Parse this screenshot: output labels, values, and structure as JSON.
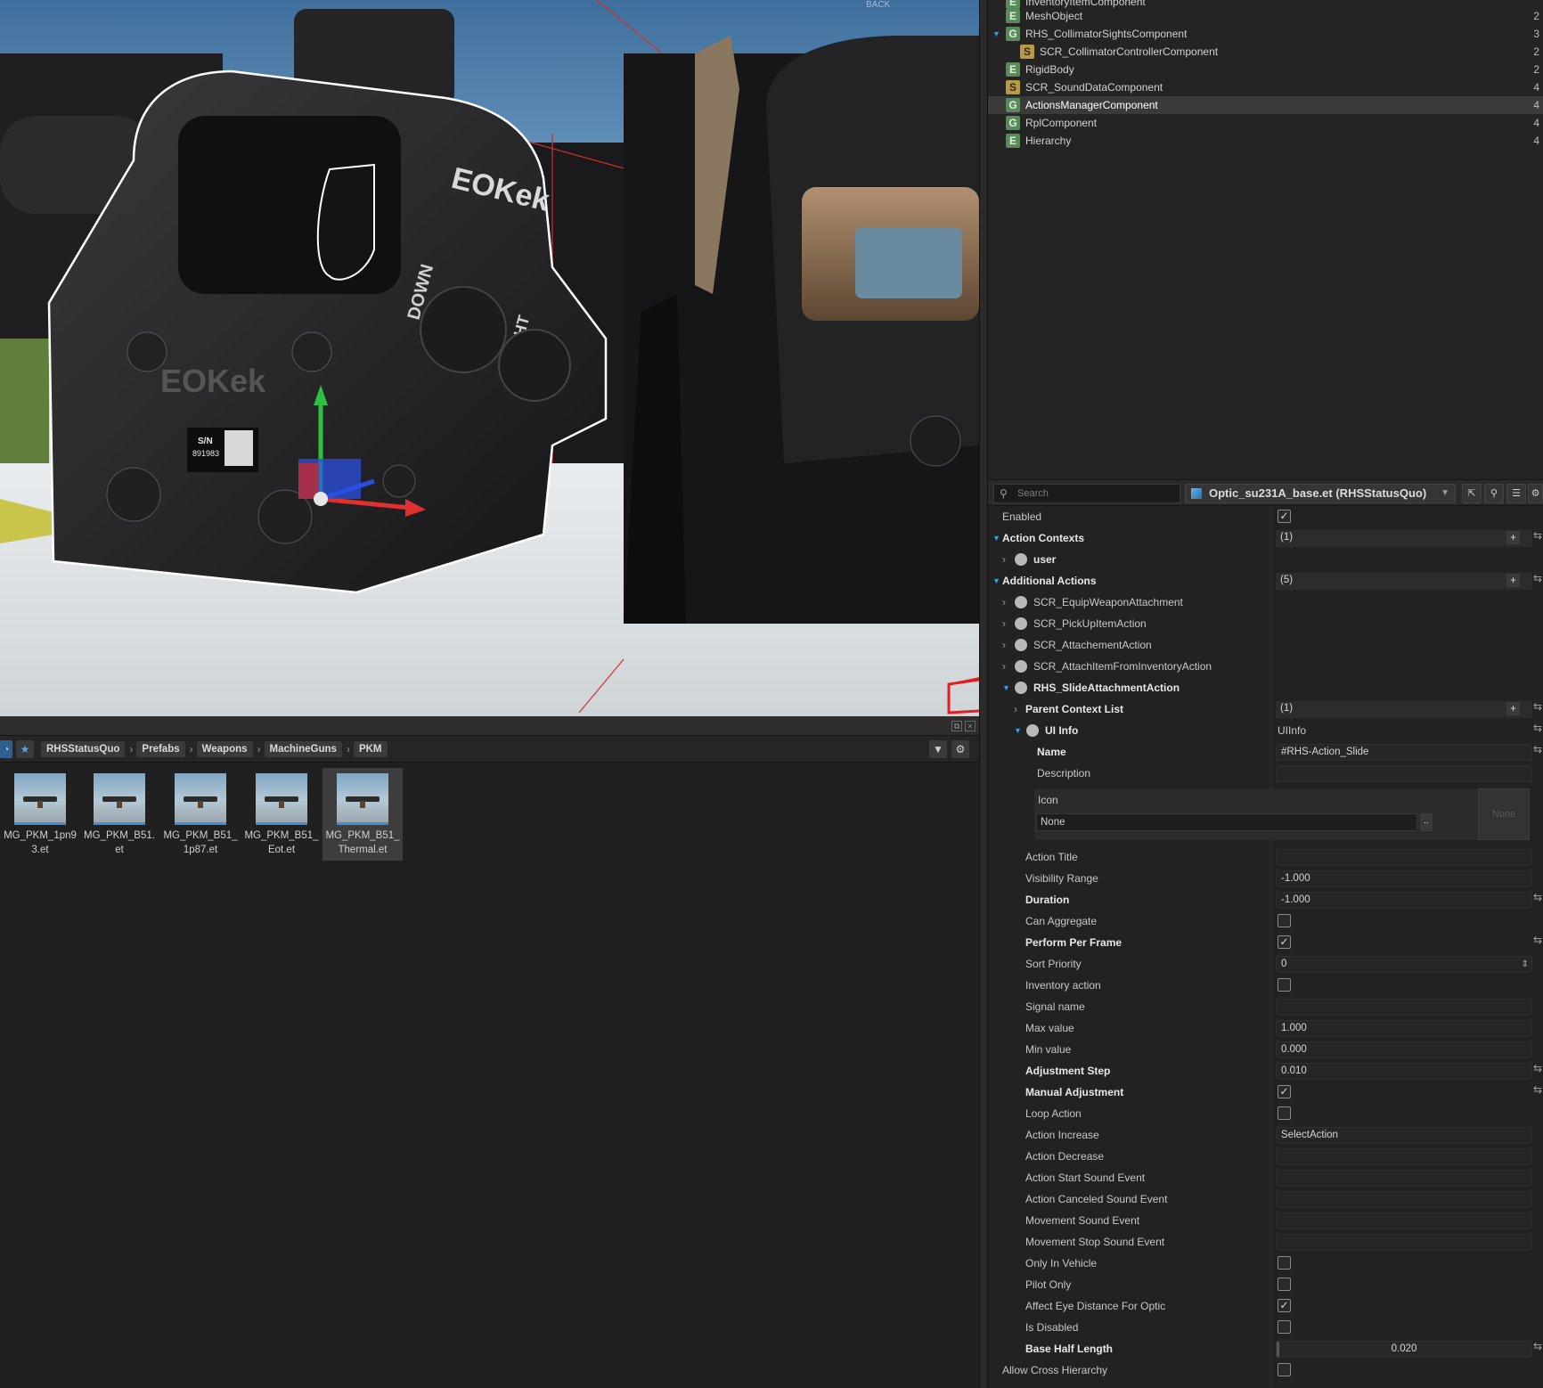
{
  "viewport": {
    "sight_brand_front": "EOKek",
    "sight_brand_side": "EOKek",
    "serial_label": "S/N",
    "serial_number": "891983",
    "dial_down": "DOWN",
    "dial_right": "RIGHT",
    "back_label": "BACK"
  },
  "hierarchy": {
    "items": [
      {
        "badge": "E",
        "name": "InventoryItemComponent",
        "count": "",
        "indent": 1,
        "caret": false
      },
      {
        "badge": "E",
        "name": "MeshObject",
        "count": "2",
        "indent": 1,
        "caret": false
      },
      {
        "badge": "G",
        "name": "RHS_CollimatorSightsComponent",
        "count": "3",
        "indent": 1,
        "caret": true
      },
      {
        "badge": "S",
        "name": "SCR_CollimatorControllerComponent",
        "count": "2",
        "indent": 2,
        "caret": false
      },
      {
        "badge": "E",
        "name": "RigidBody",
        "count": "2",
        "indent": 1,
        "caret": false
      },
      {
        "badge": "S",
        "name": "SCR_SoundDataComponent",
        "count": "4",
        "indent": 1,
        "caret": false
      },
      {
        "badge": "G",
        "name": "ActionsManagerComponent",
        "count": "4",
        "indent": 1,
        "caret": false,
        "selected": true
      },
      {
        "badge": "G",
        "name": "RplComponent",
        "count": "4",
        "indent": 1,
        "caret": false
      },
      {
        "badge": "E",
        "name": "Hierarchy",
        "count": "4",
        "indent": 1,
        "caret": false
      }
    ]
  },
  "props_toolbar": {
    "search_placeholder": "Search",
    "entity": "Optic_su231A_base.et (RHSStatusQuo)"
  },
  "properties": {
    "enabled": {
      "label": "Enabled",
      "checked": true
    },
    "action_contexts": {
      "label": "Action Contexts",
      "count": "(1)"
    },
    "user": "user",
    "additional_actions": {
      "label": "Additional Actions",
      "count": "(5)"
    },
    "actions": [
      "SCR_EquipWeaponAttachment",
      "SCR_PickUpItemAction",
      "SCR_AttachementAction",
      "SCR_AttachItemFromInventoryAction",
      "RHS_SlideAttachmentAction"
    ],
    "parent_context_list": {
      "label": "Parent Context List",
      "count": "(1)"
    },
    "ui_info": {
      "label": "UI Info",
      "value": "UIInfo"
    },
    "name": {
      "label": "Name",
      "value": "#RHS-Action_Slide"
    },
    "description": {
      "label": "Description",
      "value": ""
    },
    "icon": {
      "label": "Icon",
      "value": "None",
      "browse": "..",
      "preview": "None"
    },
    "action_title": {
      "label": "Action Title",
      "value": ""
    },
    "visibility_range": {
      "label": "Visibility Range",
      "value": "-1.000"
    },
    "duration": {
      "label": "Duration",
      "value": "-1.000"
    },
    "can_aggregate": {
      "label": "Can Aggregate",
      "checked": false
    },
    "perform_per_frame": {
      "label": "Perform Per Frame",
      "checked": true
    },
    "sort_priority": {
      "label": "Sort  Priority",
      "value": "0"
    },
    "inventory_action": {
      "label": "Inventory action",
      "checked": false
    },
    "signal_name": {
      "label": "Signal name",
      "value": ""
    },
    "max_value": {
      "label": "Max value",
      "value": "1.000"
    },
    "min_value": {
      "label": "Min value",
      "value": "0.000"
    },
    "adjustment_step": {
      "label": "Adjustment Step",
      "value": "0.010"
    },
    "manual_adjustment": {
      "label": "Manual Adjustment",
      "checked": true
    },
    "loop_action": {
      "label": "Loop Action",
      "checked": false
    },
    "action_increase": {
      "label": "Action Increase",
      "value": "SelectAction"
    },
    "action_decrease": {
      "label": "Action Decrease",
      "value": ""
    },
    "action_start_sound": {
      "label": "Action Start Sound Event",
      "value": ""
    },
    "action_canceled_sound": {
      "label": "Action Canceled Sound Event",
      "value": ""
    },
    "movement_sound": {
      "label": "Movement Sound Event",
      "value": ""
    },
    "movement_stop_sound": {
      "label": "Movement Stop Sound Event",
      "value": ""
    },
    "only_in_vehicle": {
      "label": "Only In Vehicle",
      "checked": false
    },
    "pilot_only": {
      "label": "Pilot Only",
      "checked": false
    },
    "affect_eye_distance": {
      "label": "Affect Eye Distance For Optic",
      "checked": true
    },
    "is_disabled": {
      "label": "Is Disabled",
      "checked": false
    },
    "base_half_length": {
      "label": "Base Half Length",
      "value": "0.020"
    },
    "allow_cross_hierarchy": {
      "label": "Allow Cross Hierarchy",
      "checked": false
    }
  },
  "asset_browser": {
    "breadcrumbs": [
      "RHSStatusQuo",
      "Prefabs",
      "Weapons",
      "MachineGuns",
      "PKM"
    ],
    "files": [
      {
        "line1": "MG_PKM_1pn9",
        "line2": "3.et"
      },
      {
        "line1": "MG_PKM_B51.",
        "line2": "et"
      },
      {
        "line1": "MG_PKM_B51_",
        "line2": "1p87.et"
      },
      {
        "line1": "MG_PKM_B51_",
        "line2": "Eot.et"
      },
      {
        "line1": "MG_PKM_B51_",
        "line2": "Thermal.et",
        "selected": true
      }
    ]
  },
  "colors": {
    "accent_blue": "#3f9be0",
    "selection_bg": "#3a3a3a",
    "badge_green": "#5a8a5a",
    "badge_yellow": "#b99a44",
    "gizmo_red": "#e03030",
    "gizmo_green": "#30c040",
    "gizmo_blue": "#2a50e0"
  }
}
